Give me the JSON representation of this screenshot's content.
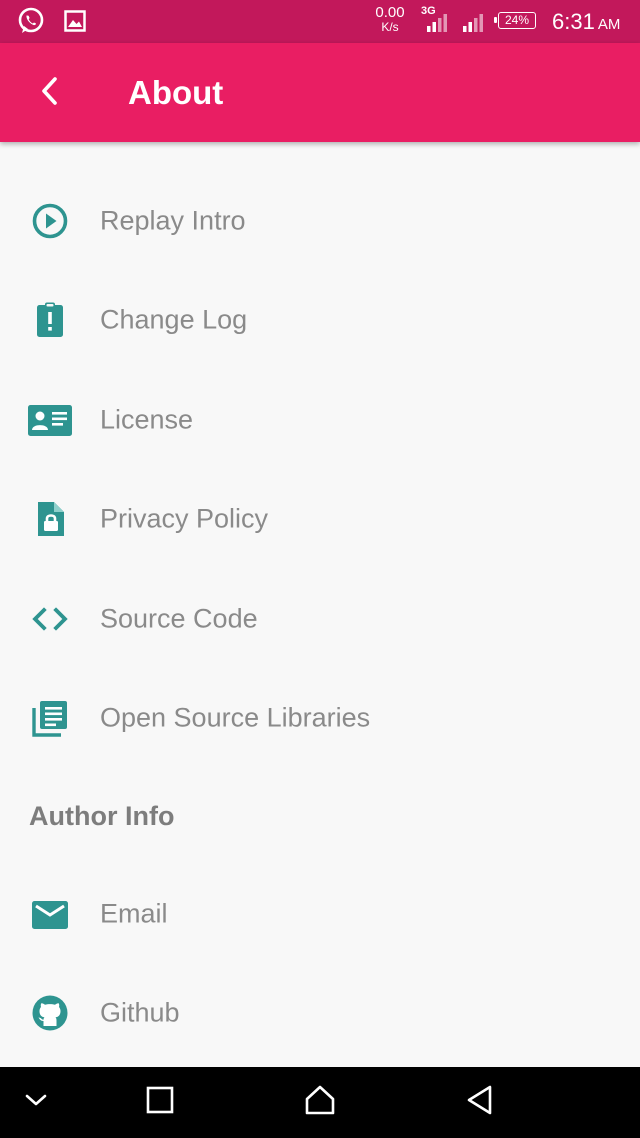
{
  "status_bar": {
    "net_speed": "0.00",
    "net_speed_unit": "K/s",
    "network_type": "3G",
    "battery": "24%",
    "time": "6:31",
    "ampm": "AM",
    "icons": [
      "whatsapp-icon",
      "gallery-icon",
      "signal-icon",
      "signal-icon",
      "battery-icon"
    ]
  },
  "app_bar": {
    "title": "About",
    "back_icon": "chevron-left-icon"
  },
  "colors": {
    "status_bar": "#c2185b",
    "app_bar": "#e91e63",
    "icon_accent": "#2e9490",
    "label_text": "#8a8a8a",
    "background": "#f8f8f8"
  },
  "menu": {
    "items": [
      {
        "label": "Replay Intro",
        "icon": "play-circle-icon"
      },
      {
        "label": "Change Log",
        "icon": "clipboard-alert-icon"
      },
      {
        "label": "License",
        "icon": "id-card-icon"
      },
      {
        "label": "Privacy Policy",
        "icon": "file-lock-icon"
      },
      {
        "label": "Source Code",
        "icon": "code-icon"
      },
      {
        "label": "Open Source Libraries",
        "icon": "library-books-icon"
      }
    ]
  },
  "author": {
    "header": "Author Info",
    "items": [
      {
        "label": "Email",
        "icon": "email-icon"
      },
      {
        "label": "Github",
        "icon": "github-icon"
      }
    ]
  },
  "nav_bar": {
    "icons": [
      "chevron-down-icon",
      "recents-square-icon",
      "home-icon",
      "back-triangle-icon"
    ]
  }
}
